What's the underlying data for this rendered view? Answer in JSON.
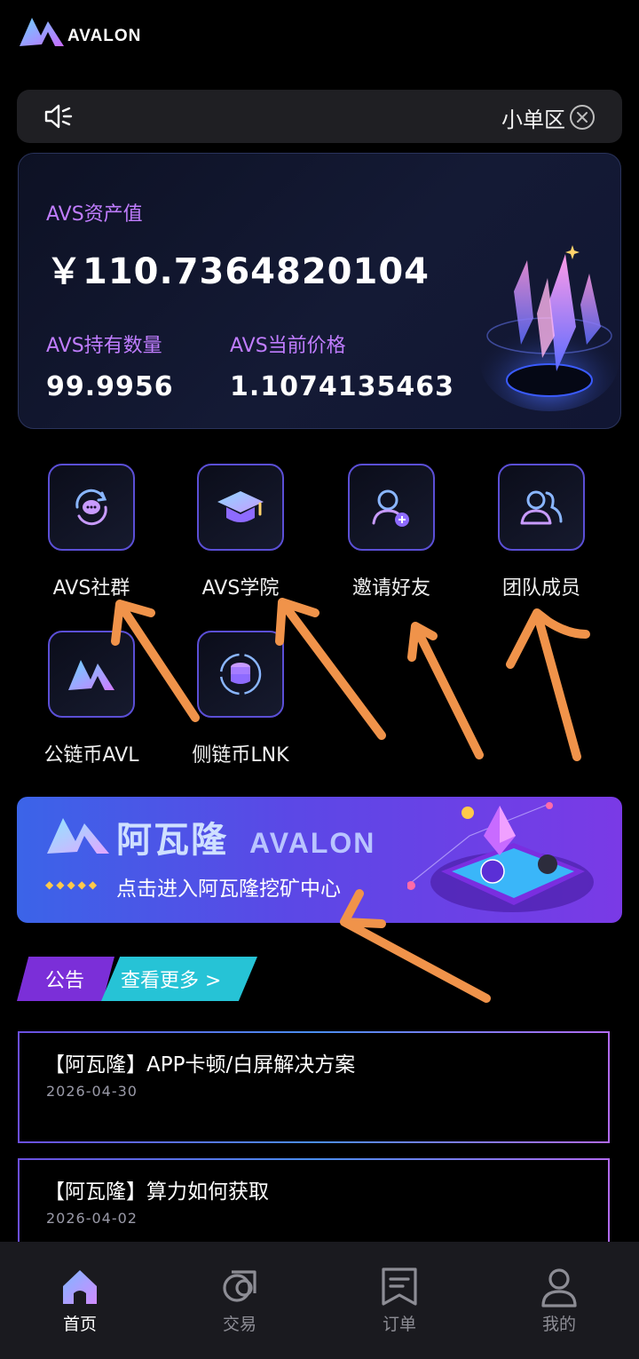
{
  "app": {
    "logo_text": "AVALON"
  },
  "notice": {
    "text": "小单区",
    "icons": [
      "speaker-icon",
      "close-circle-icon"
    ]
  },
  "asset_card": {
    "asset_label": "AVS资产值",
    "asset_value": "￥110.7364820104",
    "hold_label": "AVS持有数量",
    "hold_value": "99.9956",
    "price_label": "AVS当前价格",
    "price_value": "1.1074135463"
  },
  "grid": {
    "items": [
      {
        "label": "AVS社群",
        "icon": "chat-refresh-icon"
      },
      {
        "label": "AVS学院",
        "icon": "graduation-cap-icon"
      },
      {
        "label": "邀请好友",
        "icon": "add-user-icon"
      },
      {
        "label": "团队成员",
        "icon": "team-icon"
      },
      {
        "label": "公链币AVL",
        "icon": "avalon-logo-icon"
      },
      {
        "label": "侧链币LNK",
        "icon": "coin-stack-icon"
      }
    ]
  },
  "banner": {
    "title": "阿瓦隆",
    "brand": "AVALON",
    "subtitle": "点击进入阿瓦隆挖矿中心"
  },
  "announcements": {
    "tab_label": "公告",
    "more_label": "查看更多 >",
    "items": [
      {
        "title": "【阿瓦隆】APP卡顿/白屏解决方案",
        "date": "2026-04-30"
      },
      {
        "title": "【阿瓦隆】算力如何获取",
        "date": "2026-04-02"
      }
    ]
  },
  "bottom_nav": {
    "items": [
      {
        "label": "首页",
        "icon": "home-icon",
        "active": true
      },
      {
        "label": "交易",
        "icon": "exchange-icon",
        "active": false
      },
      {
        "label": "订单",
        "icon": "order-icon",
        "active": false
      },
      {
        "label": "我的",
        "icon": "profile-icon",
        "active": false
      }
    ]
  },
  "colors": {
    "accent_purple": "#c07dff",
    "banner_start": "#3b64e8",
    "banner_end": "#7a3ae6",
    "tab_purple": "#7b2fd8",
    "tab_cyan": "#26c3d6",
    "annotation_arrow": "#f0934a"
  }
}
